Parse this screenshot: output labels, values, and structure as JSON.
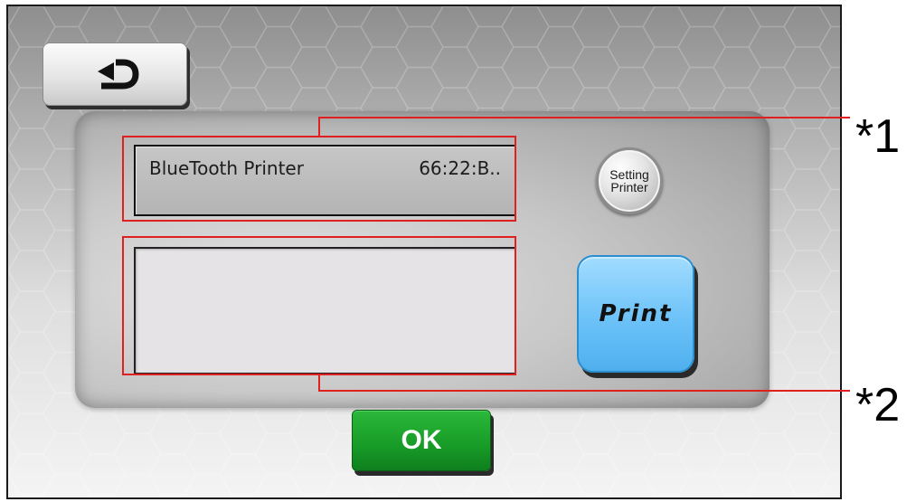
{
  "back_button": {
    "icon": "return-arrow-icon"
  },
  "printer_field": {
    "name": "BlueTooth Printer",
    "address": "66:22:B.."
  },
  "message_field": {
    "text": ""
  },
  "setting_button": {
    "line1": "Setting",
    "line2": "Printer"
  },
  "print_button": {
    "label": "Print"
  },
  "ok_button": {
    "label": "OK"
  },
  "callouts": [
    {
      "label": "*1"
    },
    {
      "label": "*2"
    }
  ],
  "colors": {
    "highlight": "#e02020",
    "print_blue": "#6cc2f8",
    "ok_green": "#179b27"
  }
}
